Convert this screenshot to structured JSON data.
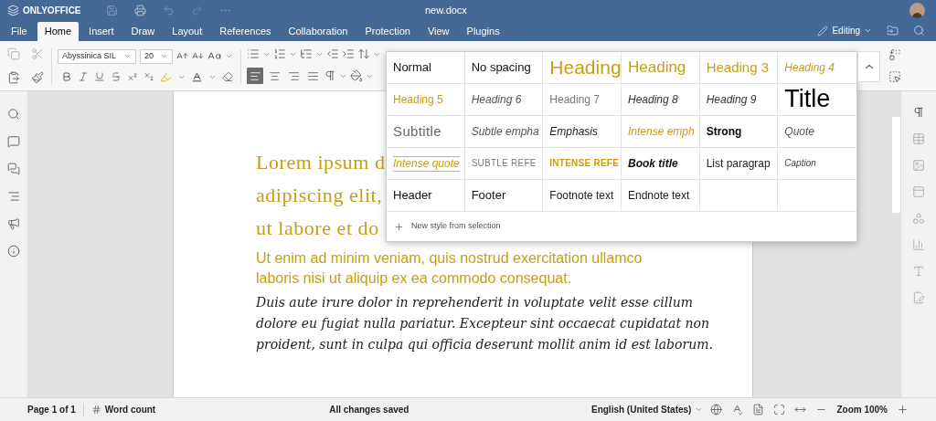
{
  "app": {
    "logo": "ONLYOFFICE",
    "title": "new.docx",
    "mode": "Editing"
  },
  "tabs": [
    {
      "label": "File",
      "selected": false
    },
    {
      "label": "Home",
      "selected": true
    },
    {
      "label": "Insert",
      "selected": false
    },
    {
      "label": "Draw",
      "selected": false
    },
    {
      "label": "Layout",
      "selected": false
    },
    {
      "label": "References",
      "selected": false
    },
    {
      "label": "Collaboration",
      "selected": false
    },
    {
      "label": "Protection",
      "selected": false
    },
    {
      "label": "View",
      "selected": false
    },
    {
      "label": "Plugins",
      "selected": false
    }
  ],
  "toolbar": {
    "font": "Abyssinica SIL",
    "size": "20",
    "alignment": [
      {
        "kind": "left",
        "selected": true
      },
      {
        "kind": "center",
        "selected": false
      },
      {
        "kind": "right",
        "selected": false
      },
      {
        "kind": "justify",
        "selected": false
      }
    ]
  },
  "document": {
    "paragraphs": [
      {
        "kind": "title",
        "lines": [
          "Lorem ipsum d",
          "adipiscing elit,",
          "ut labore et do"
        ]
      },
      {
        "kind": "heading",
        "lines": [
          "Ut enim ad minim veniam, quis nostrud exercitation ullamco",
          "laboris nisi ut aliquip ex ea commodo consequat."
        ]
      },
      {
        "kind": "quote",
        "lines": [
          "Duis aute irure dolor in reprehenderit in voluptate velit esse cillum",
          "dolore eu fugiat nulla pariatur. Excepteur sint occaecat cupidatat non",
          "proident, sunt in culpa qui officia deserunt mollit anim id est laborum."
        ]
      }
    ]
  },
  "style_gallery": {
    "styles": [
      {
        "label": "Normal",
        "kind": "normal"
      },
      {
        "label": "No spacing",
        "kind": "normal"
      },
      {
        "label": "Heading",
        "kind": "heading1"
      },
      {
        "label": "Heading",
        "kind": "heading2"
      },
      {
        "label": "Heading 3",
        "kind": "heading3"
      },
      {
        "label": "Heading 4",
        "kind": "heading4"
      },
      {
        "label": "Heading 5",
        "kind": "heading5"
      },
      {
        "label": "Heading 6",
        "kind": "heading6"
      },
      {
        "label": "Heading 7",
        "kind": "heading7"
      },
      {
        "label": "Heading 8",
        "kind": "heading8"
      },
      {
        "label": "Heading 9",
        "kind": "heading8"
      },
      {
        "label": "Title",
        "kind": "title"
      },
      {
        "label": "Subtitle",
        "kind": "subtitle"
      },
      {
        "label": "Subtle empha",
        "kind": "subtle_emphasis"
      },
      {
        "label": "Emphasis",
        "kind": "emphasis"
      },
      {
        "label": "Intense emph",
        "kind": "intense_emphasis"
      },
      {
        "label": "Strong",
        "kind": "strong"
      },
      {
        "label": "Quote",
        "kind": "subtle_emphasis"
      },
      {
        "label": "Intense quote",
        "kind": "intense_quote"
      },
      {
        "label": "SUBTLE REFE",
        "kind": "subtle_reference"
      },
      {
        "label": "INTENSE REFE",
        "kind": "intense_reference"
      },
      {
        "label": "Book title",
        "kind": "book_title"
      },
      {
        "label": "List paragrap",
        "kind": "small"
      },
      {
        "label": "Caption",
        "kind": "caption"
      },
      {
        "label": "Header",
        "kind": "normal"
      },
      {
        "label": "Footer",
        "kind": "normal"
      },
      {
        "label": "Footnote text",
        "kind": "small"
      },
      {
        "label": "Endnote text",
        "kind": "small"
      }
    ],
    "new_style": "New style from selection"
  },
  "status_bar": {
    "page": "Page 1 of 1",
    "word_count": "Word count",
    "save_state": "All changes saved",
    "language": "English (United States)",
    "zoom": "Zoom 100%"
  }
}
